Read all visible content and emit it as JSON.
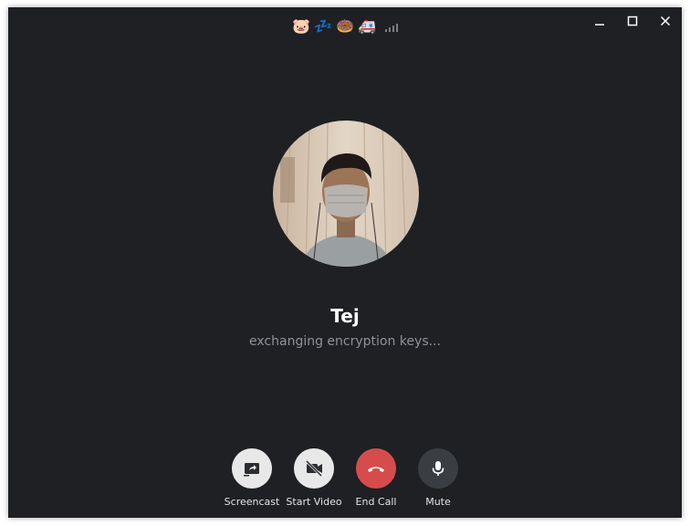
{
  "window": {
    "emojis": [
      "🐷",
      "💤",
      "🍩",
      "🚑"
    ],
    "controls": {
      "minimize_icon": "minimize-icon",
      "maximize_icon": "maximize-icon",
      "close_icon": "close-icon"
    }
  },
  "call": {
    "name": "Tej",
    "status": "exchanging encryption keys..."
  },
  "controls": [
    {
      "label": "Screencast",
      "icon": "screencast-icon",
      "color": "#e8e8e8"
    },
    {
      "label": "Start Video",
      "icon": "video-off-icon",
      "color": "#e8e8e8"
    },
    {
      "label": "End Call",
      "icon": "end-call-icon",
      "color": "#d64c4c"
    },
    {
      "label": "Mute",
      "icon": "microphone-icon",
      "color": "#3a3d42"
    }
  ],
  "colors": {
    "background": "#1e2024",
    "end_call": "#d64c4c",
    "status_text": "#8e9196"
  }
}
